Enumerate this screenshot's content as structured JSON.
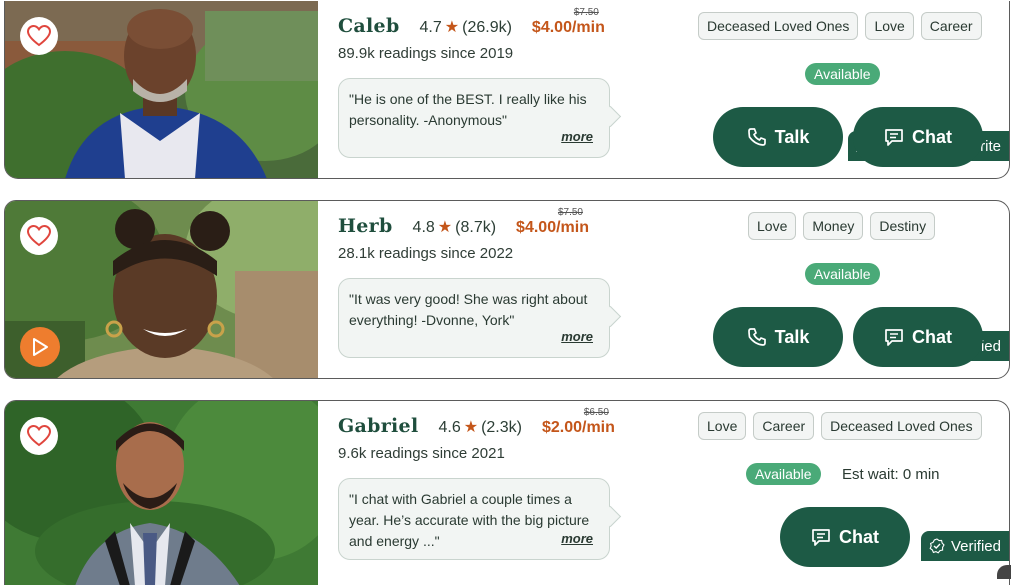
{
  "cards": [
    {
      "name": "Caleb",
      "rating": "4.7",
      "reviews": "(26.9k)",
      "price": "$4.00/min",
      "old_price": "$7.50",
      "readings": "89.9k readings since 2019",
      "quote": "\"He is one of the BEST. I really like his personality. -Anonymous\"",
      "more": "more",
      "badge": "Customer Favorite",
      "tags": [
        "Deceased Loved Ones",
        "Love",
        "Career"
      ],
      "status": "Available",
      "talk": "Talk",
      "chat": "Chat"
    },
    {
      "name": "Herb",
      "rating": "4.8",
      "reviews": "(8.7k)",
      "price": "$4.00/min",
      "old_price": "$7.50",
      "readings": "28.1k readings since 2022",
      "quote": "\"It was very good! She was right about everything! -Dvonne, York\"",
      "more": "more",
      "badge": "Verified",
      "tags": [
        "Love",
        "Money",
        "Destiny"
      ],
      "status": "Available",
      "talk": "Talk",
      "chat": "Chat"
    },
    {
      "name": "Gabriel",
      "rating": "4.6",
      "reviews": "(2.3k)",
      "price": "$2.00/min",
      "old_price": "$6.50",
      "readings": "9.6k readings since 2021",
      "quote": "\"I chat with Gabriel a couple times a year. He’s accurate with the big picture and energy ...\"",
      "more": "more",
      "badge": "Verified",
      "tags": [
        "Love",
        "Career",
        "Deceased Loved Ones"
      ],
      "status": "Available",
      "wait": "Est wait: 0 min",
      "chat": "Chat"
    }
  ],
  "icons": {
    "favorite": "heart-outline-icon",
    "play": "play-icon",
    "phone": "phone-icon",
    "chat": "chat-bubble-icon",
    "verified": "verified-badge-icon",
    "favorite_badge": "users-icon",
    "rating": "star-icon"
  },
  "colors": {
    "brand_green": "#1d5a45",
    "available_green": "#4aaa78",
    "price_orange": "#c4561a",
    "play_orange": "#ee7d2e"
  }
}
